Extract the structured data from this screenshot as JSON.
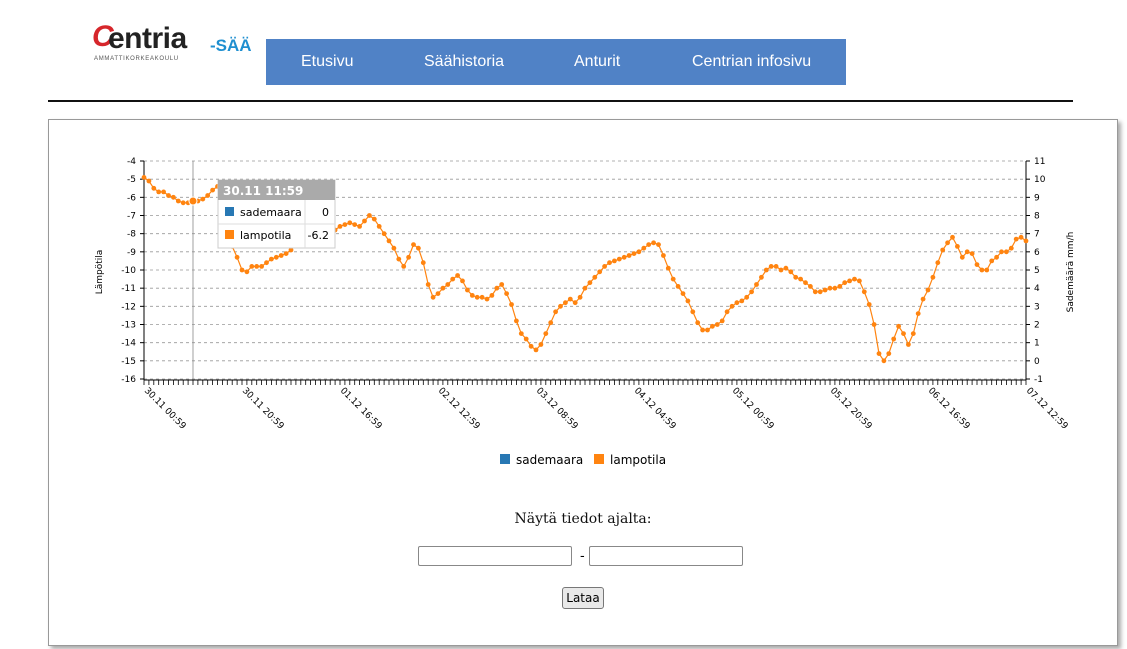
{
  "logo": {
    "mark": "C",
    "word": "entria",
    "suffix": "-SÄÄ",
    "sub": "AMMATTIKORKEAKOULU"
  },
  "nav": {
    "items": [
      "Etusivu",
      "Säähistoria",
      "Anturit",
      "Centrian infosivu"
    ]
  },
  "form": {
    "title": "Näytä tiedot ajalta:",
    "start_value": "",
    "end_value": "",
    "separator": "-",
    "load_label": "Lataa"
  },
  "colors": {
    "nav": "#5082c6",
    "sademaara": "#2878b4",
    "lampotila": "#ff8410"
  },
  "chart_data": {
    "type": "line",
    "ylabel_left": "Lämpötila",
    "ylabel_right": "Sademäärä mm/h",
    "ylim_left": [
      -16,
      -4
    ],
    "ylim_right": [
      -1,
      11
    ],
    "grid": true,
    "legend_position": "bottom",
    "x_tick_labels": [
      "30.11 00:59",
      "30.11 20:59",
      "01.12 16:59",
      "02.12 12:59",
      "03.12 08:59",
      "04.12 04:59",
      "05.12 00:59",
      "05.12 20:59",
      "06.12 16:59",
      "07.12 12:59"
    ],
    "series": [
      {
        "name": "sademaara",
        "axis": "right",
        "color": "#2878b4",
        "values": []
      },
      {
        "name": "lampotila",
        "axis": "left",
        "color": "#ff8410",
        "values": [
          -4.9,
          -5.1,
          -5.5,
          -5.7,
          -5.7,
          -5.9,
          -6.0,
          -6.2,
          -6.3,
          -6.3,
          -6.2,
          -6.2,
          -6.1,
          -5.9,
          -5.6,
          -5.4,
          -5.8,
          -7.5,
          -8.7,
          -9.3,
          -10.0,
          -10.1,
          -9.8,
          -9.8,
          -9.8,
          -9.6,
          -9.4,
          -9.3,
          -9.2,
          -9.1,
          -8.9,
          -8.6,
          -8.0,
          -7.2,
          -6.9,
          -7.0,
          -7.3,
          -7.6,
          -7.9,
          -7.8,
          -7.6,
          -7.5,
          -7.4,
          -7.5,
          -7.6,
          -7.3,
          -7.0,
          -7.2,
          -7.6,
          -8.0,
          -8.4,
          -8.8,
          -9.4,
          -9.8,
          -9.3,
          -8.6,
          -8.8,
          -9.6,
          -10.8,
          -11.5,
          -11.3,
          -11.0,
          -10.8,
          -10.5,
          -10.3,
          -10.6,
          -11.1,
          -11.4,
          -11.5,
          -11.5,
          -11.6,
          -11.4,
          -11.0,
          -10.8,
          -11.3,
          -11.9,
          -12.8,
          -13.5,
          -13.8,
          -14.2,
          -14.4,
          -14.1,
          -13.5,
          -12.9,
          -12.3,
          -12.0,
          -11.8,
          -11.6,
          -11.8,
          -11.5,
          -11.0,
          -10.7,
          -10.4,
          -10.1,
          -9.8,
          -9.6,
          -9.5,
          -9.4,
          -9.3,
          -9.2,
          -9.1,
          -9.0,
          -8.8,
          -8.6,
          -8.5,
          -8.6,
          -9.2,
          -9.9,
          -10.5,
          -10.9,
          -11.3,
          -11.7,
          -12.3,
          -12.9,
          -13.3,
          -13.3,
          -13.1,
          -13.0,
          -12.8,
          -12.3,
          -12.0,
          -11.8,
          -11.7,
          -11.5,
          -11.2,
          -10.8,
          -10.4,
          -10.0,
          -9.8,
          -9.8,
          -10.0,
          -9.9,
          -10.1,
          -10.4,
          -10.5,
          -10.7,
          -10.9,
          -11.2,
          -11.2,
          -11.1,
          -11.0,
          -11.0,
          -10.9,
          -10.7,
          -10.6,
          -10.5,
          -10.6,
          -11.2,
          -11.9,
          -13.0,
          -14.6,
          -15.0,
          -14.6,
          -13.8,
          -13.1,
          -13.5,
          -14.1,
          -13.5,
          -12.4,
          -11.6,
          -11.1,
          -10.4,
          -9.6,
          -8.9,
          -8.5,
          -8.2,
          -8.7,
          -9.3,
          -9.0,
          -9.1,
          -9.7,
          -10.0,
          -10.0,
          -9.5,
          -9.3,
          -9.0,
          -9.0,
          -8.8,
          -8.3,
          -8.2,
          -8.4
        ]
      }
    ],
    "tooltip": {
      "title": "30.11 11:59",
      "rows": [
        {
          "name": "sademaara",
          "value": "0"
        },
        {
          "name": "lampotila",
          "value": "-6.2"
        }
      ]
    }
  }
}
